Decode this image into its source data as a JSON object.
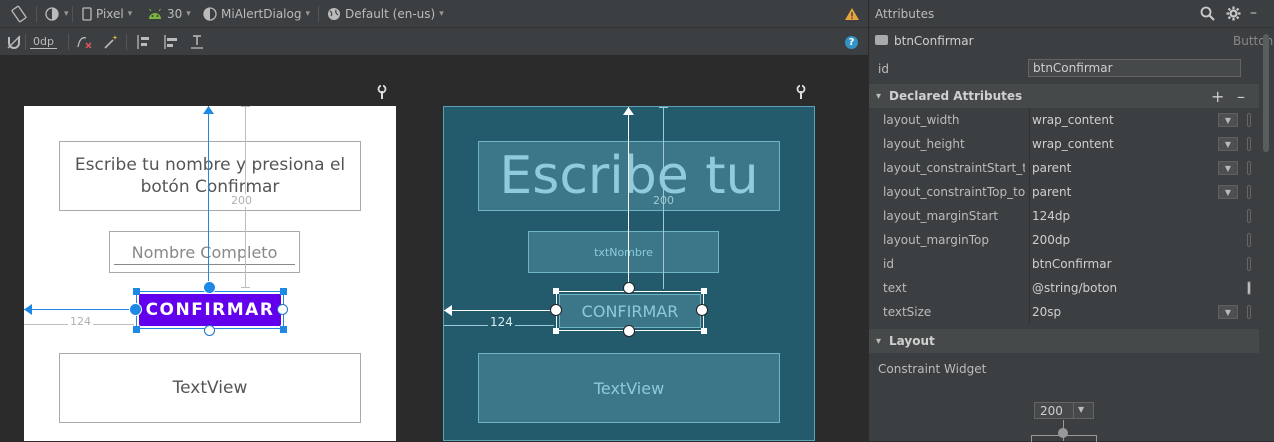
{
  "toolbar": {
    "device": "Pixel",
    "api_level": "30",
    "theme": "MiAlertDialog",
    "locale": "Default (en-us)",
    "margin_value": "0dp"
  },
  "design_preview": {
    "title_text": "Escribe tu nombre y presiona el botón Confirmar",
    "name_hint": "Nombre Completo",
    "button_label": "CONFIRMAR",
    "textview_label": "TextView",
    "margin_top_label": "200",
    "margin_start_label": "124"
  },
  "blueprint_preview": {
    "title_text": "Escribe tu",
    "name_id": "txtNombre",
    "button_label": "CONFIRMAR",
    "textview_label": "TextView",
    "margin_top_label": "200",
    "margin_start_label": "124"
  },
  "attributes": {
    "panel_title": "Attributes",
    "component_name": "btnConfirmar",
    "component_type": "Button",
    "id_label": "id",
    "id_value": "btnConfirmar",
    "declared_title": "Declared Attributes",
    "declared": [
      {
        "key": "layout_width",
        "value": "wrap_content",
        "dropdown": true
      },
      {
        "key": "layout_height",
        "value": "wrap_content",
        "dropdown": true
      },
      {
        "key": "layout_constraintStart_to...",
        "value": "parent",
        "dropdown": true
      },
      {
        "key": "layout_constraintTop_toT...",
        "value": "parent",
        "dropdown": true
      },
      {
        "key": "layout_marginStart",
        "value": "124dp",
        "dropdown": false
      },
      {
        "key": "layout_marginTop",
        "value": "200dp",
        "dropdown": false
      },
      {
        "key": "id",
        "value": "btnConfirmar",
        "dropdown": false
      },
      {
        "key": "text",
        "value": "@string/boton",
        "dropdown": false
      },
      {
        "key": "textSize",
        "value": "20sp",
        "dropdown": true
      }
    ],
    "layout_title": "Layout",
    "constraint_widget_label": "Constraint Widget",
    "constraint_top_value": "200"
  },
  "colors": {
    "accent": "#1e88e5",
    "button_bg": "#6200ee",
    "blueprint_bg": "#235b6d",
    "warning": "#e8a33d"
  }
}
